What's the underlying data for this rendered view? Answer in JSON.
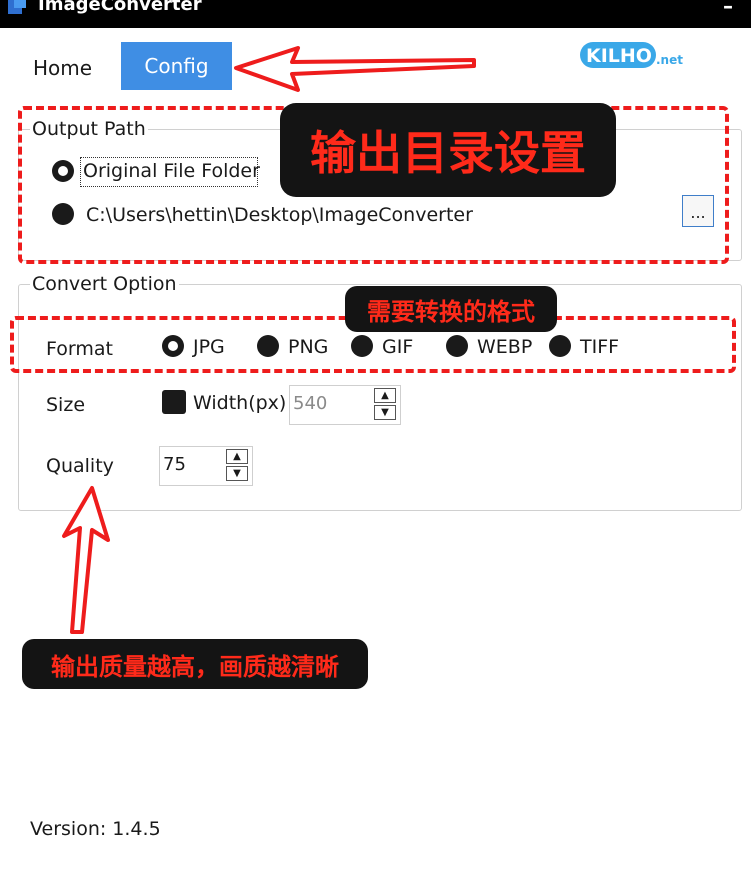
{
  "window": {
    "title": "ImageConverter",
    "close_glyph": "–"
  },
  "tabs": {
    "home": "Home",
    "config": "Config"
  },
  "logo": {
    "main": "KILHO",
    "suffix": ".net"
  },
  "output_path": {
    "legend": "Output Path",
    "original_label": "Original File Folder",
    "custom_path": "C:\\Users\\hettin\\Desktop\\ImageConverter",
    "browse_label": "...",
    "selected": "original"
  },
  "convert_option": {
    "legend": "Convert Option",
    "format_label": "Format",
    "formats": [
      "JPG",
      "PNG",
      "GIF",
      "WEBP",
      "TIFF"
    ],
    "selected_format": "JPG",
    "size_label": "Size",
    "width_label": "Width(px)",
    "width_value": "540",
    "quality_label": "Quality",
    "quality_value": "75"
  },
  "version": "Version: 1.4.5",
  "annotations": {
    "output_dir": "输出目录设置",
    "format": "需要转换的格式",
    "quality": "输出质量越高，画质越清晰"
  },
  "colors": {
    "accent": "#3f8ee4",
    "annotation_red": "#ee1c1c",
    "callout_bg": "#141414"
  }
}
